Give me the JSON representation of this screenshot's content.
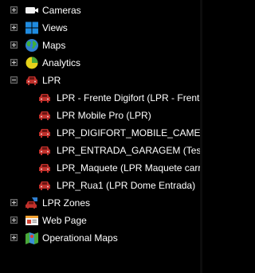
{
  "tree": {
    "roots": [
      {
        "label": "Cameras",
        "expanded": false,
        "icon": "camera-icon"
      },
      {
        "label": "Views",
        "expanded": false,
        "icon": "windows-grid-icon"
      },
      {
        "label": "Maps",
        "expanded": false,
        "icon": "globe-icon"
      },
      {
        "label": "Analytics",
        "expanded": false,
        "icon": "pie-chart-icon"
      },
      {
        "label": "LPR",
        "expanded": true,
        "icon": "car-icon",
        "children": [
          {
            "label": "LPR - Frente Digifort (LPR - Frente",
            "icon": "car-icon"
          },
          {
            "label": "LPR Mobile Pro (LPR)",
            "icon": "car-icon"
          },
          {
            "label": "LPR_DIGIFORT_MOBILE_CAMERA",
            "icon": "car-icon"
          },
          {
            "label": "LPR_ENTRADA_GARAGEM (Test d",
            "icon": "car-icon"
          },
          {
            "label": "LPR_Maquete (LPR Maquete carro",
            "icon": "car-icon"
          },
          {
            "label": "LPR_Rua1 (LPR Dome Entrada)",
            "icon": "car-icon"
          }
        ]
      },
      {
        "label": "LPR Zones",
        "expanded": false,
        "icon": "car-zone-icon"
      },
      {
        "label": "Web Page",
        "expanded": false,
        "icon": "web-page-icon"
      },
      {
        "label": "Operational Maps",
        "expanded": false,
        "icon": "map-icon"
      }
    ]
  },
  "colors": {
    "background": "#000000",
    "text": "#ffffff",
    "car": "#c0302b",
    "globe_blue": "#2f7fd0",
    "globe_green": "#3fae3a",
    "chart_yellow": "#e6d21a",
    "chart_green": "#49a83a",
    "windows_blue": "#1f8be0"
  }
}
